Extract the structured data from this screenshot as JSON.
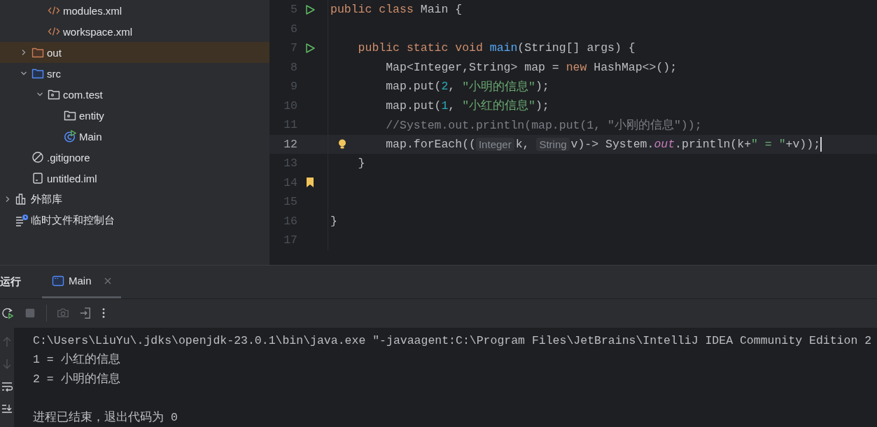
{
  "project_tree": {
    "items": [
      {
        "children": [
          {
            "children": [
              {
                "label": "modules.xml",
                "kind": "xml",
                "selected": false
              },
              {
                "label": "workspace.xml",
                "kind": "xml",
                "selected": false
              }
            ]
          },
          {
            "label": "out",
            "kind": "excluded-folder",
            "expanded": false,
            "selected": true
          },
          {
            "label": "src",
            "kind": "source-folder",
            "expanded": true,
            "selected": false,
            "children": [
              {
                "label": "com.test",
                "kind": "package",
                "expanded": true,
                "selected": false,
                "children": [
                  {
                    "label": "entity",
                    "kind": "package",
                    "selected": false
                  },
                  {
                    "label": "Main",
                    "kind": "main-class",
                    "selected": false
                  }
                ]
              }
            ]
          },
          {
            "label": ".gitignore",
            "kind": "ignore",
            "selected": false
          },
          {
            "label": "untitled.iml",
            "kind": "module-file",
            "selected": false
          }
        ]
      },
      {
        "label": "外部库",
        "kind": "library",
        "expanded": false,
        "selected": false
      },
      {
        "label": "临时文件和控制台",
        "kind": "scratches",
        "selected": false
      }
    ]
  },
  "editor": {
    "lines": [
      {
        "number": "5",
        "kind": "run",
        "current": false,
        "tokens": [
          {
            "kind": "keyword",
            "text": "public class "
          },
          {
            "kind": "plain",
            "text": "Main {"
          }
        ]
      },
      {
        "number": "6",
        "kind": "plain",
        "current": false
      },
      {
        "number": "7",
        "kind": "run",
        "current": false,
        "tokens": [
          {
            "kind": "keyword",
            "text": "    public static void "
          },
          {
            "kind": "method",
            "text": "main"
          },
          {
            "kind": "plain",
            "text": "(String[] args) {"
          }
        ]
      },
      {
        "number": "8",
        "kind": "plain",
        "current": false,
        "tokens": [
          {
            "kind": "plain",
            "text": "        Map<Integer,String> map = "
          },
          {
            "kind": "keyword",
            "text": "new"
          },
          {
            "kind": "plain",
            "text": " HashMap<>();"
          }
        ]
      },
      {
        "number": "9",
        "kind": "plain",
        "current": false,
        "tokens": [
          {
            "kind": "plain",
            "text": "        map.put("
          },
          {
            "kind": "number",
            "text": "2"
          },
          {
            "kind": "plain",
            "text": ", "
          },
          {
            "kind": "string",
            "text": "\"小明的信息\""
          },
          {
            "kind": "plain",
            "text": ");"
          }
        ]
      },
      {
        "number": "10",
        "kind": "plain",
        "current": false,
        "tokens": [
          {
            "kind": "plain",
            "text": "        map.put("
          },
          {
            "kind": "number",
            "text": "1"
          },
          {
            "kind": "plain",
            "text": ", "
          },
          {
            "kind": "string",
            "text": "\"小红的信息\""
          },
          {
            "kind": "plain",
            "text": ");"
          }
        ]
      },
      {
        "number": "11",
        "kind": "plain",
        "current": false,
        "tokens": [
          {
            "kind": "comment",
            "text": "        //System.out.println(map.put(1, \"小刚的信息\"));"
          }
        ]
      },
      {
        "number": "12",
        "kind": "bulb",
        "current": true,
        "tokens": [
          {
            "kind": "plain",
            "text": "        map.forEach(("
          },
          {
            "kind": "hint",
            "text": "Integer"
          },
          {
            "kind": "plain",
            "text": "k, "
          },
          {
            "kind": "hint",
            "text": "String"
          },
          {
            "kind": "plain",
            "text": "v)-> System."
          },
          {
            "kind": "field",
            "text": "out"
          },
          {
            "kind": "plain",
            "text": ".println(k+"
          },
          {
            "kind": "string",
            "text": "\" = \""
          },
          {
            "kind": "plain",
            "text": "+v));"
          }
        ]
      },
      {
        "number": "13",
        "kind": "plain",
        "current": false,
        "tokens": [
          {
            "kind": "plain",
            "text": "    }"
          }
        ]
      },
      {
        "number": "14",
        "kind": "bookmark",
        "current": false
      },
      {
        "number": "15",
        "kind": "plain",
        "current": false
      },
      {
        "number": "16",
        "kind": "plain",
        "current": false,
        "tokens": [
          {
            "kind": "plain",
            "text": "}"
          }
        ]
      },
      {
        "number": "17",
        "kind": "plain",
        "current": false
      }
    ]
  },
  "run_panel": {
    "title": "运行",
    "tabs": [
      {
        "label": "Main",
        "selected": true,
        "closable": true
      }
    ],
    "console": [
      {
        "kind": "command",
        "text": "C:\\Users\\LiuYu\\.jdks\\openjdk-23.0.1\\bin\\java.exe \"-javaagent:C:\\Program Files\\JetBrains\\IntelliJ IDEA Community Edition 2"
      },
      {
        "kind": "output",
        "text": "1 = 小红的信息"
      },
      {
        "kind": "output",
        "text": "2 = 小明的信息"
      },
      {
        "kind": "status",
        "text": "进程已结束，退出代码为 0"
      }
    ]
  }
}
